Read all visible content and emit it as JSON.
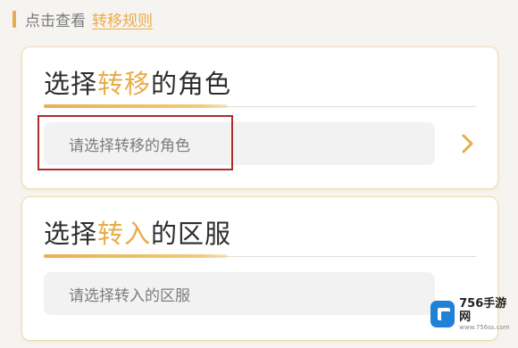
{
  "header": {
    "hint": "点击查看",
    "rules_link": "转移规则"
  },
  "transfer_role": {
    "title_prefix": "选择",
    "title_highlight": "转移",
    "title_suffix": "的角色",
    "placeholder": "请选择转移的角色"
  },
  "transfer_server": {
    "title_prefix": "选择",
    "title_highlight": "转入",
    "title_suffix": "的区服",
    "placeholder": "请选择转入的区服"
  },
  "watermark": {
    "brand": "756手游网",
    "site": "www.756ss.com"
  },
  "colors": {
    "accent": "#e9ac4b",
    "annotation": "#b02c2c",
    "card_border": "#f0dcb2"
  },
  "icons": {
    "role_arrow": "chevron-right-icon",
    "logo": "756-logo-icon"
  }
}
